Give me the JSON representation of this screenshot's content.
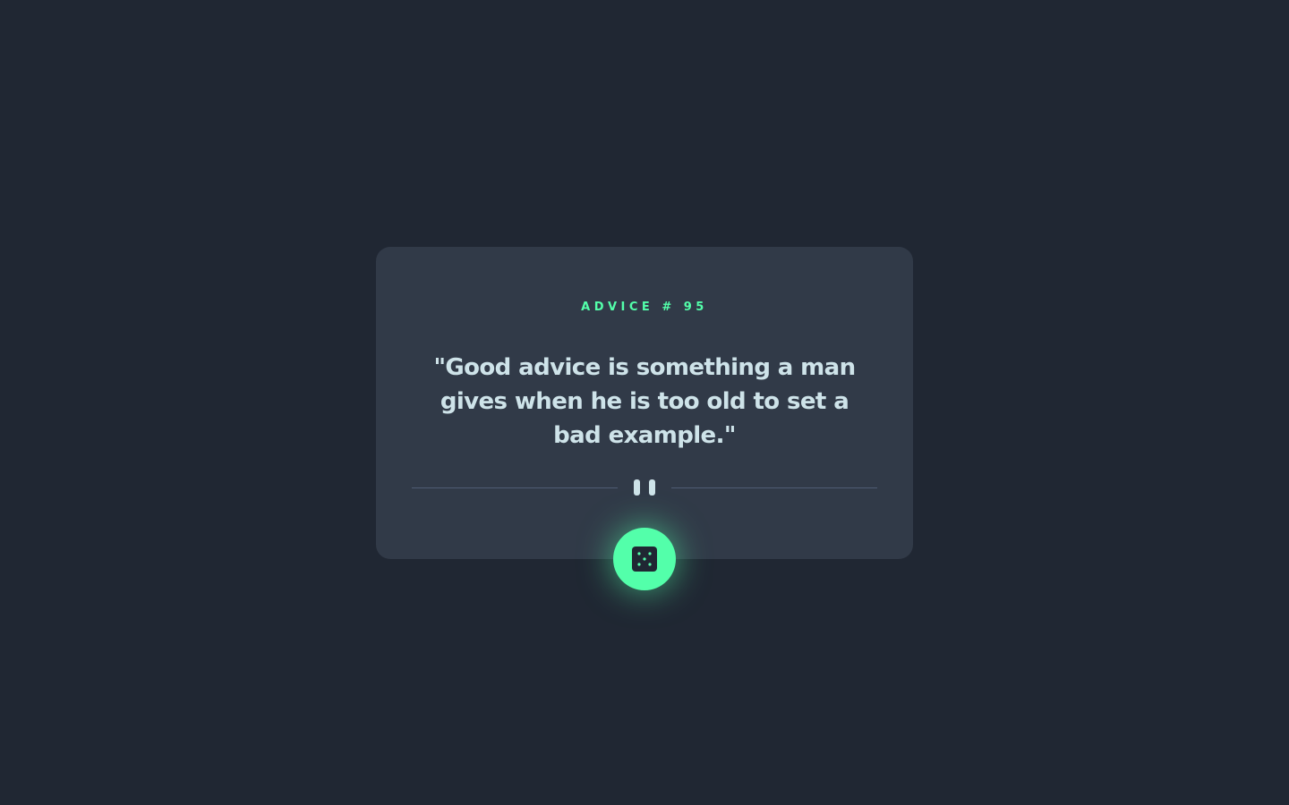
{
  "advice": {
    "heading": "ADVICE # 95",
    "quote": "\"Good advice is something a man gives when he is too old to set a bad example.\""
  },
  "divider": {
    "icon": "pause-icon"
  },
  "action": {
    "icon": "dice-icon"
  },
  "colors": {
    "background": "#202733",
    "card": "#313a48",
    "accent": "#53ffaa",
    "text": "#cee3e9",
    "divider": "#4f5d74"
  }
}
